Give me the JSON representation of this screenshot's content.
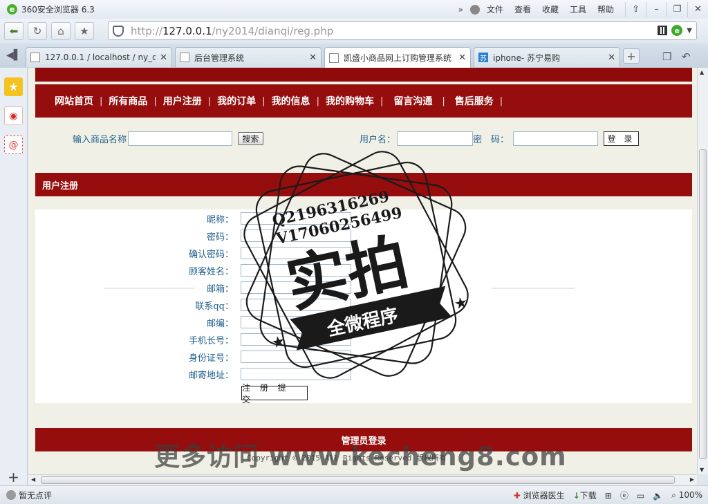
{
  "window": {
    "app_title": "360安全浏览器 6.3",
    "menu": [
      "文件",
      "查看",
      "收藏",
      "工具",
      "帮助"
    ],
    "controls": [
      "⇧",
      "–",
      "❐",
      "✕"
    ]
  },
  "address": {
    "url_prefix": "http://",
    "url_host": "127.0.0.1",
    "url_path": "/ny2014/dianqi/reg.php"
  },
  "tabs": [
    {
      "label": "127.0.0.1 / localhost / ny_di",
      "active": false
    },
    {
      "label": "后台管理系统",
      "active": false
    },
    {
      "label": "凯盛小商品网上订购管理系统",
      "active": true
    },
    {
      "label": "iphone- 苏宁易购",
      "active": false
    }
  ],
  "site": {
    "nav": [
      "网站首页",
      "所有商品",
      "用户注册",
      "我的订单",
      "我的信息",
      "我的购物车",
      "留言沟通",
      "售后服务"
    ],
    "search": {
      "label": "输入商品名称",
      "button": "搜索",
      "value": ""
    },
    "login": {
      "username_label": "用户名：",
      "password_label": "密　码：",
      "button": "登 录"
    },
    "panel_title": "用户注册",
    "form_fields": [
      "昵称：",
      "密码：",
      "确认密码：",
      "顾客姓名：",
      "邮箱：",
      "联系qq：",
      "邮编：",
      "手机长号：",
      "身份证号：",
      "邮寄地址："
    ],
    "submit": "注 册 提 交",
    "footer_title": "管理员登录",
    "copyright": "Copyright © 2015 All Rights Reserved 版权所有"
  },
  "watermark": {
    "qq": "Q2196316269",
    "v": "V17060256499",
    "main": "实拍",
    "ribbon": "全微程序",
    "site": "更多访问 www.kecheng8.com"
  },
  "status": {
    "left": "暂无点评",
    "doctor": "浏览器医生",
    "download": "下载",
    "zoom": "100%"
  },
  "colors": {
    "nav_red": "#960d0d",
    "label_teal": "#1f5f8b",
    "content_bg": "#f1f0e6"
  }
}
